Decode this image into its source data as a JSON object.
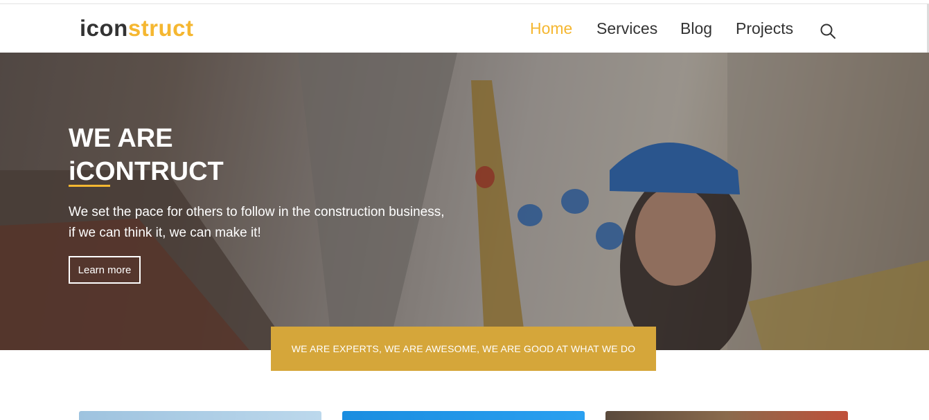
{
  "header": {
    "logo_part1": "icon",
    "logo_part2": "struct",
    "nav": [
      "Home",
      "Services",
      "Blog",
      "Projects"
    ],
    "active": "Home",
    "search_icon": "search-icon"
  },
  "hero": {
    "title_line1": "WE ARE",
    "title_line2": "iCONTRUCT",
    "text_line1": "We set the pace for others to follow in the construction business,",
    "text_line2": "if we can think it, we can make it!",
    "button_label": "Learn more"
  },
  "banner": {
    "text": "WE ARE EXPERTS, WE ARE AWESOME, WE ARE GOOD AT WHAT WE DO"
  },
  "colors": {
    "accent": "#f5b731",
    "banner": "#d5a63a",
    "text_dark": "#333333"
  }
}
